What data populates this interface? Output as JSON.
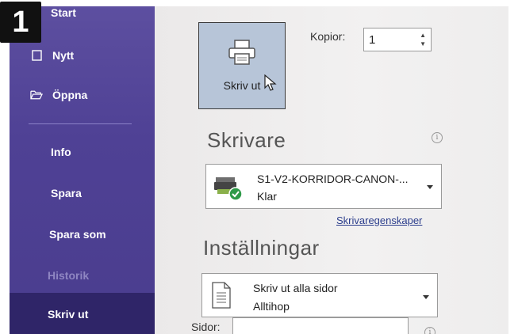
{
  "badge": "1",
  "sidebar": {
    "items": [
      {
        "label": "Start",
        "icon": "home-icon"
      },
      {
        "label": "Nytt",
        "icon": "new-document-icon"
      },
      {
        "label": "Öppna",
        "icon": "folder-open-icon"
      },
      {
        "label": "Info"
      },
      {
        "label": "Spara"
      },
      {
        "label": "Spara som"
      },
      {
        "label": "Historik",
        "state": "disabled"
      },
      {
        "label": "Skriv ut",
        "state": "active"
      }
    ]
  },
  "print": {
    "button_label": "Skriv ut",
    "copies_label": "Kopior:",
    "copies_value": "1"
  },
  "printer": {
    "section_title": "Skrivare",
    "name": "S1-V2-KORRIDOR-CANON-...",
    "status": "Klar",
    "properties_link": "Skrivaregenskaper"
  },
  "settings": {
    "section_title": "Inställningar",
    "range_title": "Skriv ut alla sidor",
    "range_subtitle": "Alltihop",
    "pages_label": "Sidor:",
    "pages_value": ""
  },
  "colors": {
    "sidebar_bg": "#4f4195",
    "sidebar_active": "#2f2568",
    "print_button_bg": "#b7c5d8",
    "link": "#2b3d8c"
  }
}
